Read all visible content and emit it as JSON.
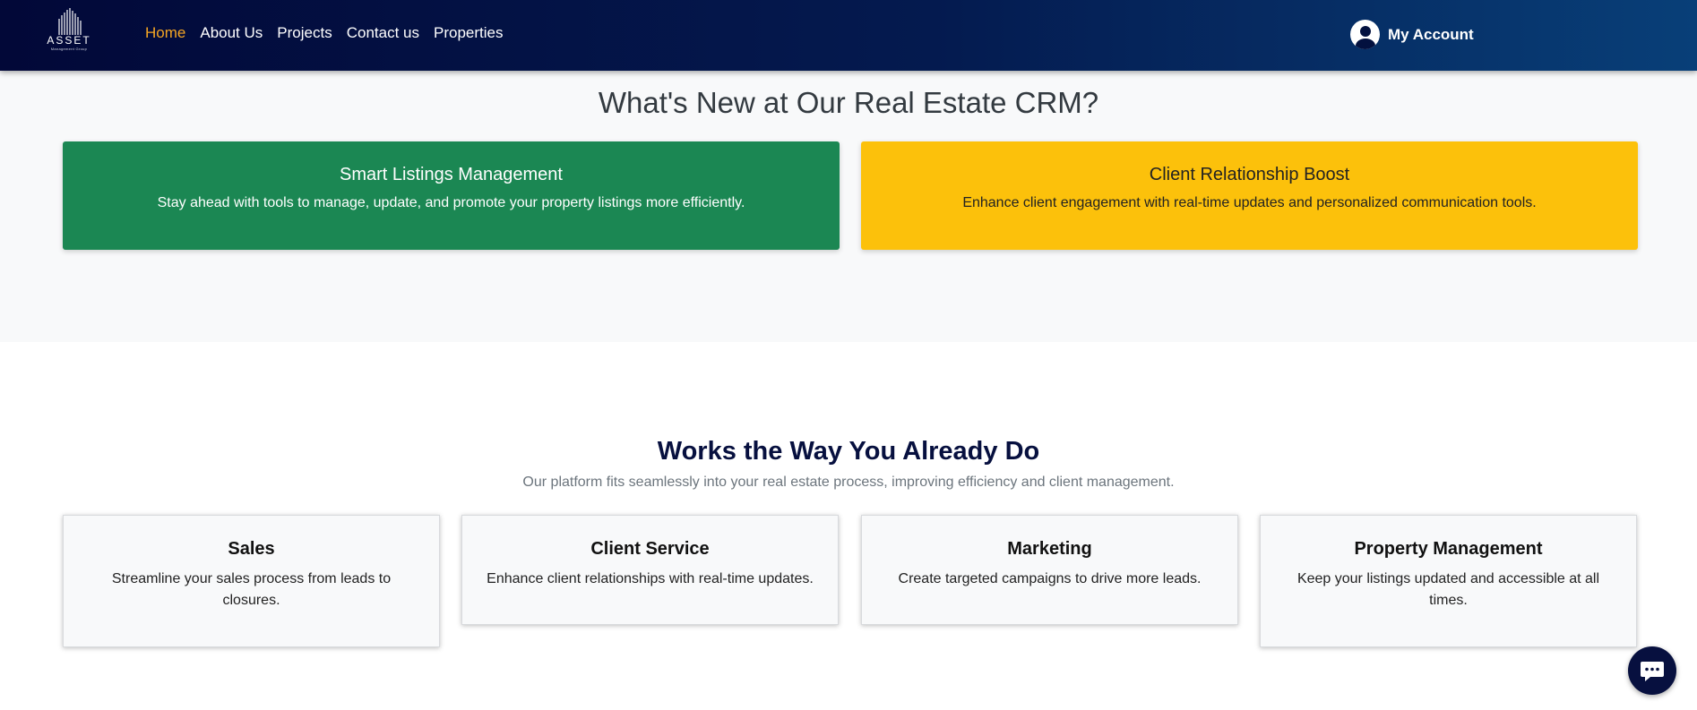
{
  "nav": {
    "logo_text": "ASSET",
    "logo_subtext": "Management Group",
    "links": [
      "Home",
      "About Us",
      "Projects",
      "Contact us",
      "Properties"
    ],
    "active_link": "Home",
    "account_label": "My Account"
  },
  "whats_new": {
    "title": "What's New at Our Real Estate CRM?",
    "cards": [
      {
        "title": "Smart Listings Management",
        "text": "Stay ahead with tools to manage, update, and promote your property listings more efficiently.",
        "color": "#1b8753"
      },
      {
        "title": "Client Relationship Boost",
        "text": "Enhance client engagement with real-time updates and personalized communication tools.",
        "color": "#fcc10b"
      }
    ]
  },
  "works": {
    "title": "Works the Way You Already Do",
    "subtitle": "Our platform fits seamlessly into your real estate process, improving efficiency and client management.",
    "cards": [
      {
        "title": "Sales",
        "text": "Streamline your sales process from leads to closures."
      },
      {
        "title": "Client Service",
        "text": "Enhance client relationships with real-time updates."
      },
      {
        "title": "Marketing",
        "text": "Create targeted campaigns to drive more leads."
      },
      {
        "title": "Property Management",
        "text": "Keep your listings updated and accessible at all times."
      }
    ]
  },
  "icons": {
    "logo": "building-logo-icon",
    "account": "user-circle-icon",
    "chat": "chat-bubble-icon"
  },
  "colors": {
    "nav_gradient_start": "#020838",
    "nav_gradient_end": "#083f78",
    "active_link": "#f5a623",
    "heading_dark": "#07103f"
  }
}
